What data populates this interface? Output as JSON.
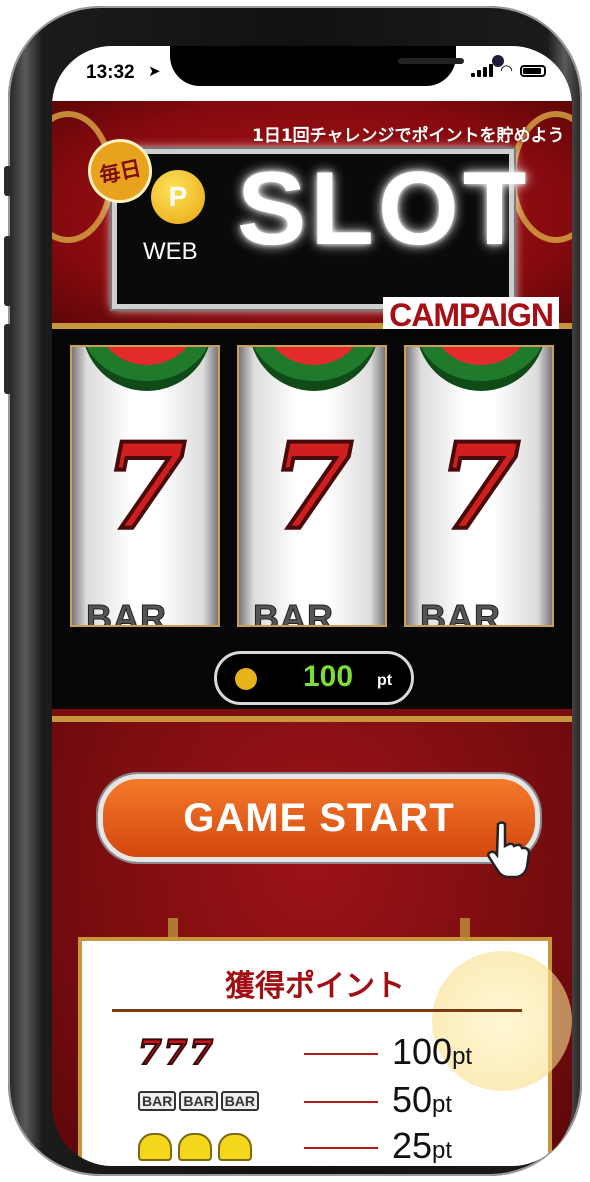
{
  "status_bar": {
    "time": "13:32"
  },
  "banner": {
    "badge": "毎日",
    "tagline": "1日1回チャレンジでポイントを貯めよう",
    "coin_letter": "P",
    "web_label": "WEB",
    "slot_label": "SLOT",
    "campaign_label": "CAMPAIGN"
  },
  "reels": [
    {
      "symbol": "7",
      "bottom": "BAR"
    },
    {
      "symbol": "7",
      "bottom": "BAR"
    },
    {
      "symbol": "7",
      "bottom": "BAR"
    }
  ],
  "points_display": {
    "value": "100",
    "unit": "pt"
  },
  "game_start_label": "GAME START",
  "prize_board": {
    "title": "獲得ポイント",
    "rows": [
      {
        "symbol": "777",
        "points": "100",
        "unit": "pt"
      },
      {
        "symbol": "BAR BAR BAR",
        "bar1": "BAR",
        "bar2": "BAR",
        "bar3": "BAR",
        "points": "50",
        "unit": "pt"
      },
      {
        "symbol": "bells",
        "points": "25",
        "unit": "pt"
      }
    ]
  },
  "colors": {
    "primary_red": "#7a0d10",
    "gold": "#c8963a",
    "button_orange": "#e8601c",
    "points_green": "#7ddb3b"
  }
}
